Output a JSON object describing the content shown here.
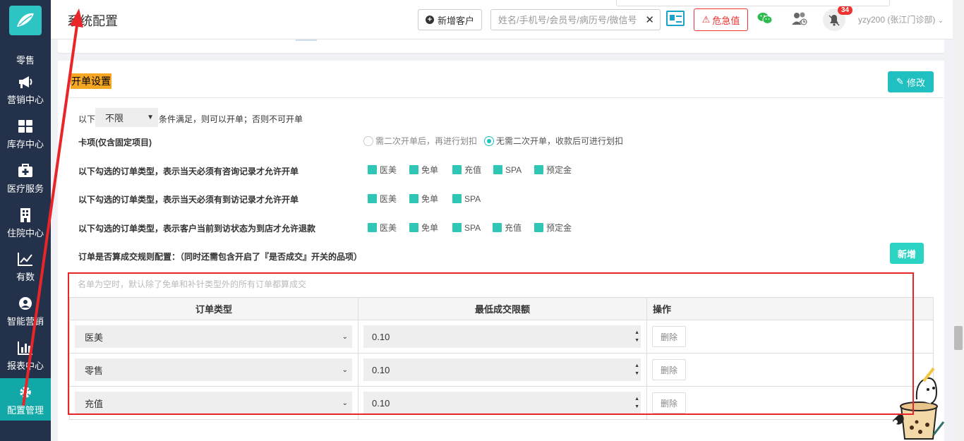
{
  "sidebar": {
    "items": [
      {
        "label": "零售",
        "icon": "retail-icon"
      },
      {
        "label": "营销中心",
        "icon": "megaphone-icon"
      },
      {
        "label": "库存中心",
        "icon": "grid-icon"
      },
      {
        "label": "医疗服务",
        "icon": "medkit-icon"
      },
      {
        "label": "住院中心",
        "icon": "building-icon"
      },
      {
        "label": "有数",
        "icon": "chart-line-icon"
      },
      {
        "label": "智能营销",
        "icon": "brain-icon"
      },
      {
        "label": "报表中心",
        "icon": "bar-chart-icon"
      },
      {
        "label": "配置管理",
        "icon": "gear-icon",
        "active": true
      }
    ]
  },
  "header": {
    "title": "系统配置",
    "new_customer": "新增客户",
    "search_placeholder": "姓名/手机号/会员号/病历号/微信号",
    "clear": "✕",
    "danger": "危急值",
    "badge_count": "34",
    "user": "yzy200 (张江门诊部)"
  },
  "section": {
    "title": "开单设置",
    "edit_label": "修改",
    "condition_prefix": "以下",
    "condition_select": "不限",
    "condition_suffix": "条件满足，则可以开单；否则不可开单",
    "card_label": "卡项(仅含固定项目)",
    "card_options": [
      "需二次开单后，再进行划扣",
      "无需二次开单，收款后可进行划扣"
    ],
    "consult_label": "以下勾选的订单类型，表示当天必须有咨询记录才允许开单",
    "consult_types": [
      "医美",
      "免单",
      "充值",
      "SPA",
      "预定金"
    ],
    "visit_label": "以下勾选的订单类型，表示当天必须有到访记录才允许开单",
    "visit_types": [
      "医美",
      "免单",
      "SPA"
    ],
    "refund_label": "以下勾选的订单类型，表示客户当前到访状态为到店才允许退款",
    "refund_types": [
      "医美",
      "免单",
      "SPA",
      "充值",
      "预定金"
    ],
    "deal_label": "订单是否算成交规则配置：（同时还需包含开启了『是否成交』开关的品项）",
    "add_label": "新增"
  },
  "rules": {
    "hint": "名单为空时，默认除了免单和补针类型外的所有订单都算成交",
    "columns": [
      "订单类型",
      "最低成交限额",
      "操作"
    ],
    "rows": [
      {
        "type": "医美",
        "amount": "0.10",
        "action": "删除"
      },
      {
        "type": "零售",
        "amount": "0.10",
        "action": "删除"
      },
      {
        "type": "充值",
        "amount": "0.10",
        "action": "删除"
      }
    ]
  },
  "colors": {
    "sidebar": "#23314a",
    "accent": "#20c0c0",
    "danger": "#e33333",
    "highlight": "#f5a623"
  }
}
